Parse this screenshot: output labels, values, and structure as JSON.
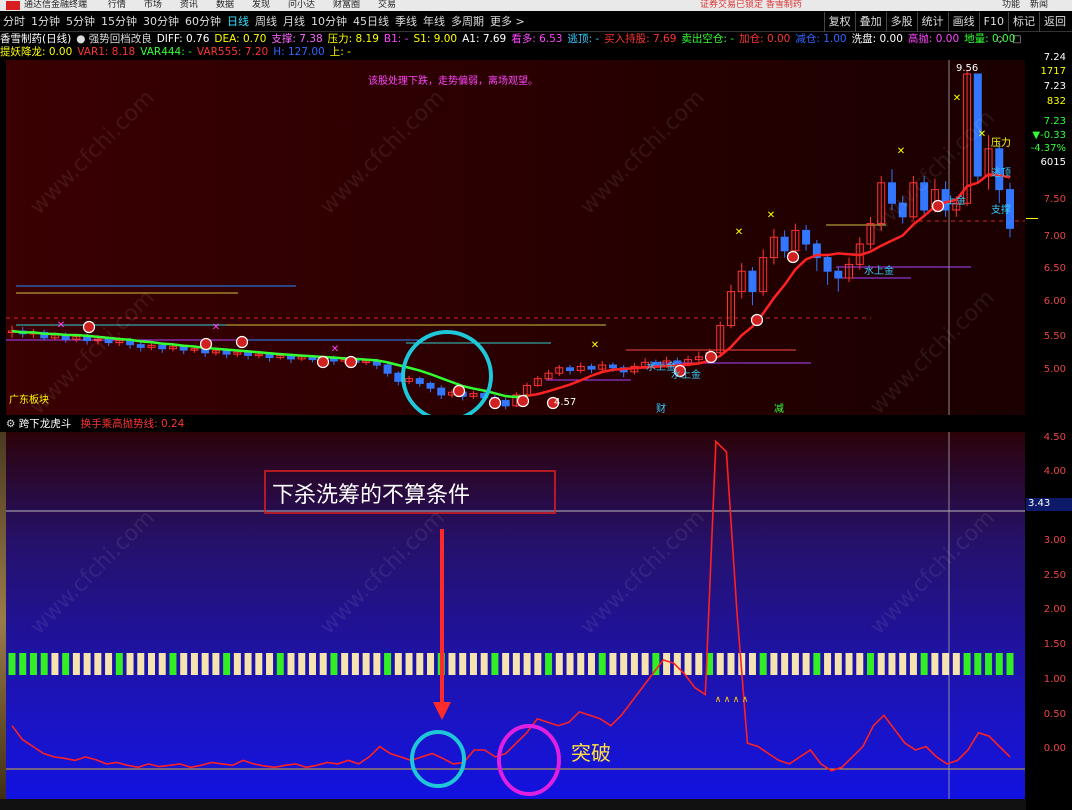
{
  "titlebar": {
    "app_name": "通达信金融终端",
    "menu": [
      "行情",
      "市场",
      "资讯",
      "数据",
      "发现",
      "问小达",
      "财富圈",
      "交易"
    ],
    "notice": "证券交易已锁定  香雪制药",
    "right_items": [
      "功能",
      "新闻"
    ]
  },
  "periods": {
    "items": [
      "分时",
      "1分钟",
      "5分钟",
      "15分钟",
      "30分钟",
      "60分钟",
      "日线",
      "周线",
      "月线",
      "10分钟",
      "45日线",
      "季线",
      "年线",
      "多周期",
      "更多 >"
    ],
    "active": "日线"
  },
  "tools": [
    "复权",
    "叠加",
    "多股",
    "统计",
    "画线",
    "F10",
    "标记",
    "返回"
  ],
  "legend1": [
    {
      "text": "香雪制药(日线)",
      "color": "#ffffff"
    },
    {
      "text": "● 强势回档改良",
      "color": "#dddddd"
    },
    {
      "text": "DIFF: 0.76",
      "color": "#ffffff"
    },
    {
      "text": "DEA: 0.70",
      "color": "#ffff00"
    },
    {
      "text": "支撑: 7.38",
      "color": "#ff66ff"
    },
    {
      "text": "压力: 8.19",
      "color": "#ffff00"
    },
    {
      "text": "B1: -",
      "color": "#ff44ff"
    },
    {
      "text": "S1: 9.00",
      "color": "#ffff00"
    },
    {
      "text": "A1: 7.69",
      "color": "#ffffff"
    },
    {
      "text": "看多: 6.53",
      "color": "#ff44ff"
    },
    {
      "text": "逃顶: -",
      "color": "#33ccff"
    },
    {
      "text": "买入持股: 7.69",
      "color": "#ff3333"
    },
    {
      "text": "卖出空仓: -",
      "color": "#33ff33"
    },
    {
      "text": "加仓: 0.00",
      "color": "#ff3333"
    },
    {
      "text": "减仓: 1.00",
      "color": "#3366ff"
    },
    {
      "text": "洗盘: 0.00",
      "color": "#ffffff"
    },
    {
      "text": "高抛: 0.00",
      "color": "#ff44ff"
    },
    {
      "text": "地量: 0.00",
      "color": "#33ff33"
    }
  ],
  "legend2": [
    {
      "text": "提妖降龙: 0.00",
      "color": "#ffff00"
    },
    {
      "text": "VAR1: 8.18",
      "color": "#ff3333"
    },
    {
      "text": "VAR444: -",
      "color": "#33ff33"
    },
    {
      "text": "VAR555: 7.20",
      "color": "#ff3333"
    },
    {
      "text": "H: 127.00",
      "color": "#3366ff"
    },
    {
      "text": "上: -",
      "color": "#ffff00"
    }
  ],
  "main_annotations": {
    "warning": "该股处理下跌，走势偏弱，离场观望。",
    "sector": "广东板块",
    "low_price": "4.57",
    "high_price": "9.56",
    "tag_fin": "财",
    "tag_reduce": "减",
    "label_ya": "压力",
    "label_tao": "逃顶",
    "label_zhi": "支撑",
    "water_labels": [
      "水上金",
      "水上金",
      "水上金",
      "上金"
    ]
  },
  "main_axis": {
    "ticks": [
      {
        "label": "7.50",
        "color": "#e64444"
      },
      {
        "label": "7.00",
        "color": "#e64444"
      },
      {
        "label": "6.50",
        "color": "#e64444"
      },
      {
        "label": "6.00",
        "color": "#e64444"
      },
      {
        "label": "5.50",
        "color": "#e64444"
      },
      {
        "label": "5.00",
        "color": "#e64444"
      }
    ],
    "quote": [
      {
        "label": "7.24",
        "color": "#ffffff"
      },
      {
        "label": "1717",
        "color": "#ffff00"
      },
      {
        "label": "7.23",
        "color": "#ffffff"
      },
      {
        "label": "832",
        "color": "#ffff00"
      },
      {
        "label": "7.23",
        "color": "#33ff33"
      },
      {
        "label": "▼-0.33",
        "color": "#33ff33"
      },
      {
        "label": "-4.37%",
        "color": "#33ff33"
      },
      {
        "label": "6015",
        "color": "#ffffff"
      }
    ]
  },
  "sub_header": {
    "name": "跨下龙虎斗",
    "line": "换手乘高抛势线: 0.24"
  },
  "sub_axis": {
    "ticks": [
      "4.50",
      "4.00",
      "3.50",
      "3.00",
      "2.50",
      "2.00",
      "1.50",
      "1.00",
      "0.50",
      "0.00"
    ],
    "current": "3.43"
  },
  "sub_annotations": {
    "callout": "下杀洗筹的不算条件",
    "breakout": "突破"
  },
  "colors": {
    "up": "#ff3333",
    "down": "#3377ff",
    "ma_green": "#33ff33",
    "ma_red": "#ff2222",
    "cyan_circle": "#1ec8d8",
    "magenta_circle": "#e020e0"
  }
}
